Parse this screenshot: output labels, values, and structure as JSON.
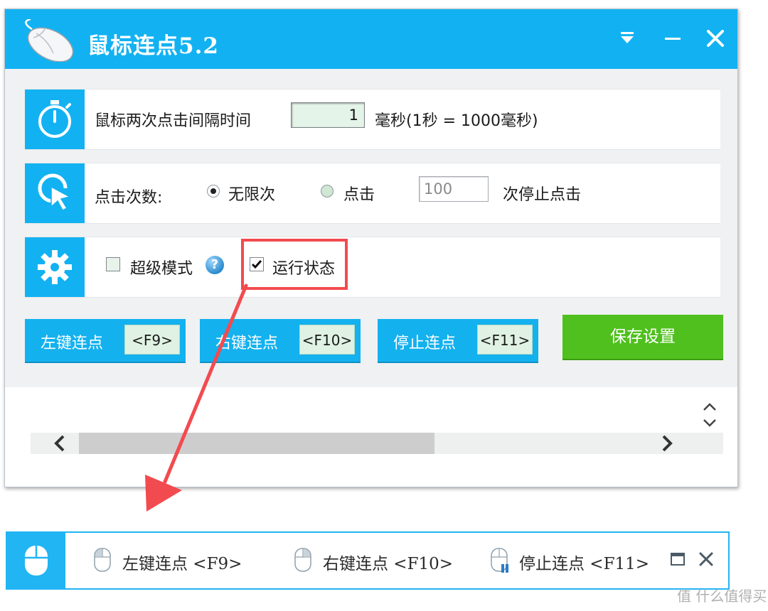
{
  "window": {
    "title": "鼠标连点5.2",
    "controls": {
      "menu": "menu",
      "minimize": "minimize",
      "close": "close"
    }
  },
  "interval": {
    "label": "鼠标两次点击间隔时间",
    "value": "1",
    "unit": "毫秒(1秒 = 1000毫秒)"
  },
  "click_count": {
    "label": "点击次数:",
    "option_unlimited": "无限次",
    "option_count": "点击",
    "count_value": "100",
    "suffix": "次停止点击",
    "selected": "无限次"
  },
  "settings": {
    "super_mode_label": "超级模式",
    "super_mode_checked": false,
    "run_state_label": "运行状态",
    "run_state_checked": true,
    "help_glyph": "?"
  },
  "actions": {
    "left_click": {
      "label": "左键连点",
      "key": "<F9>"
    },
    "right_click": {
      "label": "右键连点",
      "key": "<F10>"
    },
    "stop_click": {
      "label": "停止连点",
      "key": "<F11>"
    },
    "save": "保存设置"
  },
  "mini_bar": {
    "items": [
      {
        "label": "左键连点 <F9>"
      },
      {
        "label": "右键连点 <F10>"
      },
      {
        "label": "停止连点 <F11>"
      }
    ]
  },
  "watermark": "值 什么值得买",
  "colors": {
    "accent": "#12b2f2",
    "save": "#4fc01d",
    "highlight": "#f24b4f",
    "key_bg": "#dff2e3"
  }
}
